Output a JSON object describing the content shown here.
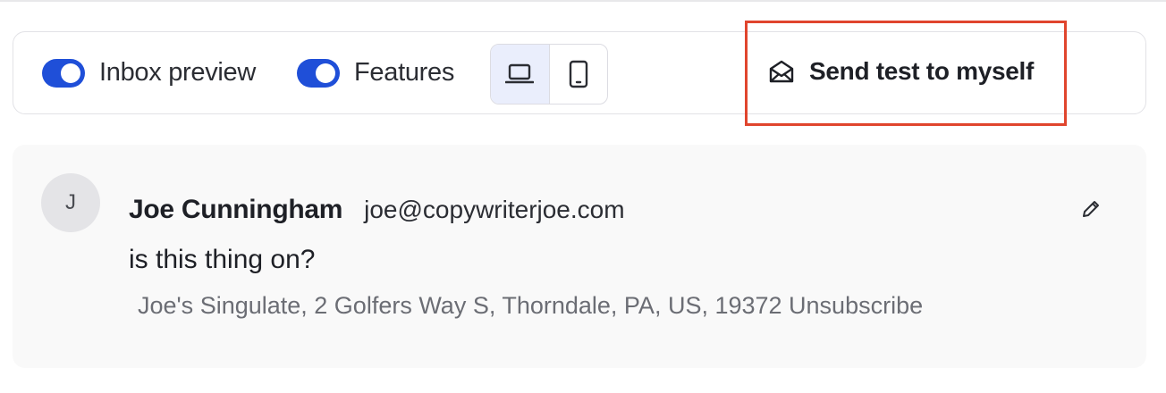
{
  "toolbar": {
    "inbox_preview": {
      "label": "Inbox preview",
      "enabled": true
    },
    "features": {
      "label": "Features",
      "enabled": true
    },
    "device_options": [
      {
        "icon": "laptop-icon",
        "active": true
      },
      {
        "icon": "mobile-icon",
        "active": false
      }
    ],
    "send_test_label": "Send test to myself",
    "send_test_icon": "envelope-open-icon",
    "accent_color": "#1f4fd8",
    "highlight_color": "#e0452d"
  },
  "email": {
    "avatar_initial": "J",
    "sender_name": "Joe Cunningham",
    "sender_email": "joe@copywriterjoe.com",
    "subject": "is this thing on?",
    "footer": "Joe's Singulate, 2 Golfers Way S, Thorndale, PA, US, 19372 Unsubscribe",
    "edit_icon": "pencil-icon"
  }
}
